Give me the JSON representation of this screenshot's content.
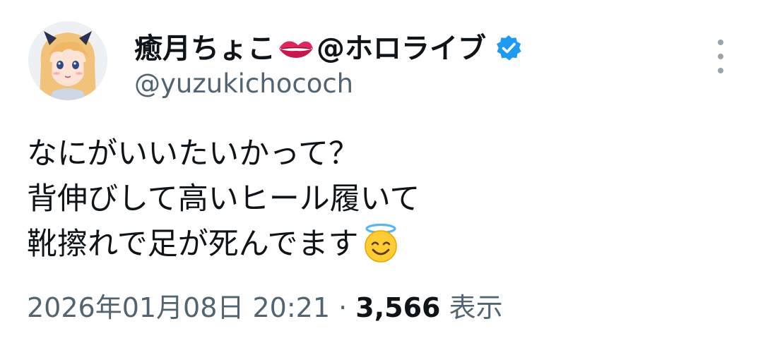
{
  "author": {
    "display_name_before": "癒月ちょこ",
    "display_name_after": "@ホロライブ",
    "handle": "@yuzukichococh",
    "icons": {
      "name_emoji": "kiss-mark-icon",
      "verified": "verified-badge-icon"
    }
  },
  "tweet": {
    "lines": [
      "なにがいいたいかって？",
      "背伸びして高いヒール履いて",
      "靴擦れで足が死んでます"
    ],
    "trailing_emoji": "smiling-face-with-halo-icon"
  },
  "meta": {
    "timestamp": "2026年01月08日 20:21",
    "separator": "·",
    "views_count": "3,566",
    "views_label": "表示"
  },
  "colors": {
    "text_primary": "#0f1419",
    "text_secondary": "#536471",
    "verified_blue": "#1d9bf0",
    "lips_red": "#e0245e"
  }
}
